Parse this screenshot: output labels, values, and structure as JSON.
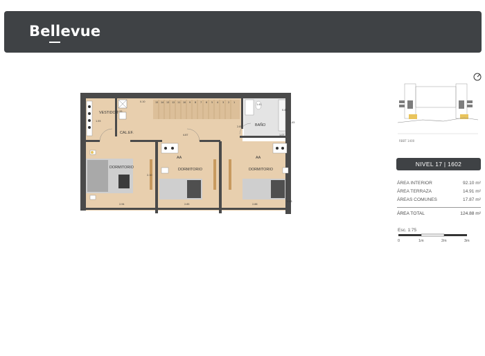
{
  "header": {
    "brand": "Bellevue"
  },
  "plan": {
    "rooms": {
      "vestidor": "VESTIDOR",
      "calef": "CAL.EF.",
      "bano": "BAÑO",
      "dormitorio_1": "DORMITORIO",
      "dormitorio_2": "DORMITORIO",
      "dormitorio_3": "DORMITORIO",
      "aa_1": "AA",
      "aa_2": "AA"
    },
    "dimensions": {
      "d1": "0.10",
      "d2": "1.55",
      "d3": "1.55",
      "d4": "4.87",
      "d5": "2.85",
      "d6": "2.10",
      "d7": "2.94",
      "d8": "2.65",
      "d9": "2.86",
      "d10": "1.41",
      "d11": "0.43",
      "d12": "1.45",
      "d13": "1.07",
      "d14": "0.43"
    },
    "stair_steps": [
      "15",
      "14",
      "13",
      "12",
      "11",
      "10",
      "9",
      "8",
      "7",
      "6",
      "5",
      "4",
      "3",
      "2",
      "1"
    ]
  },
  "keyplan": {
    "north_label": "RBBT 1400"
  },
  "level": {
    "label": "NIVEL 17 | 1602"
  },
  "areas": {
    "interior": {
      "label": "ÁREA INTERIOR",
      "value": "92.10 m²"
    },
    "terraza": {
      "label": "ÁREA TERRAZA",
      "value": "14.91 m²"
    },
    "comunes": {
      "label": "ÁREAS COMUNES",
      "value": "17.87 m²"
    },
    "total": {
      "label": "ÁREA TOTAL",
      "value": "124.88 m²"
    }
  },
  "scale": {
    "label": "Esc. 1:75",
    "ticks": [
      "0",
      "1m",
      "2m",
      "3m"
    ]
  }
}
